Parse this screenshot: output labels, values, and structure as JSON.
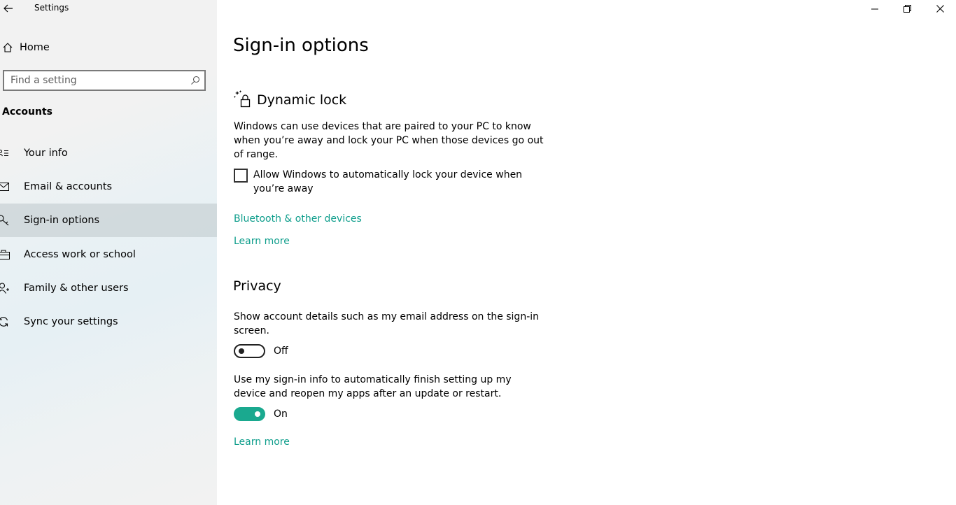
{
  "window": {
    "title": "Settings",
    "controls": {
      "minimize": "minimize-icon",
      "restore": "restore-icon",
      "close": "close-icon"
    }
  },
  "sidebar": {
    "home_label": "Home",
    "search": {
      "placeholder": "Find a setting",
      "value": ""
    },
    "section_title": "Accounts",
    "items": [
      {
        "label": "Your info",
        "icon": "contact-card-icon"
      },
      {
        "label": "Email & accounts",
        "icon": "mail-icon"
      },
      {
        "label": "Sign-in options",
        "icon": "key-icon",
        "selected": true
      },
      {
        "label": "Access work or school",
        "icon": "briefcase-icon"
      },
      {
        "label": "Family & other users",
        "icon": "person-add-icon"
      },
      {
        "label": "Sync your settings",
        "icon": "sync-icon"
      }
    ]
  },
  "main": {
    "title": "Sign-in options",
    "dynamic_lock": {
      "heading": "Dynamic lock",
      "description": "Windows can use devices that are paired to your PC to know when you’re away and lock your PC when those devices go out of range.",
      "checkbox_label": "Allow Windows to automatically lock your device when you’re away",
      "checkbox_checked": false,
      "link_bluetooth": "Bluetooth & other devices",
      "link_learn_more": "Learn more"
    },
    "privacy": {
      "heading": "Privacy",
      "setting1_text": "Show account details such as my email address on the sign-in screen.",
      "setting1_state": "Off",
      "setting2_text": "Use my sign-in info to automatically finish setting up my device and reopen my apps after an update or restart.",
      "setting2_state": "On",
      "link_learn_more": "Learn more"
    }
  },
  "colors": {
    "accent": "#1aa98f",
    "link": "#0f9e8c",
    "selected_bg": "#cdd3d6"
  }
}
